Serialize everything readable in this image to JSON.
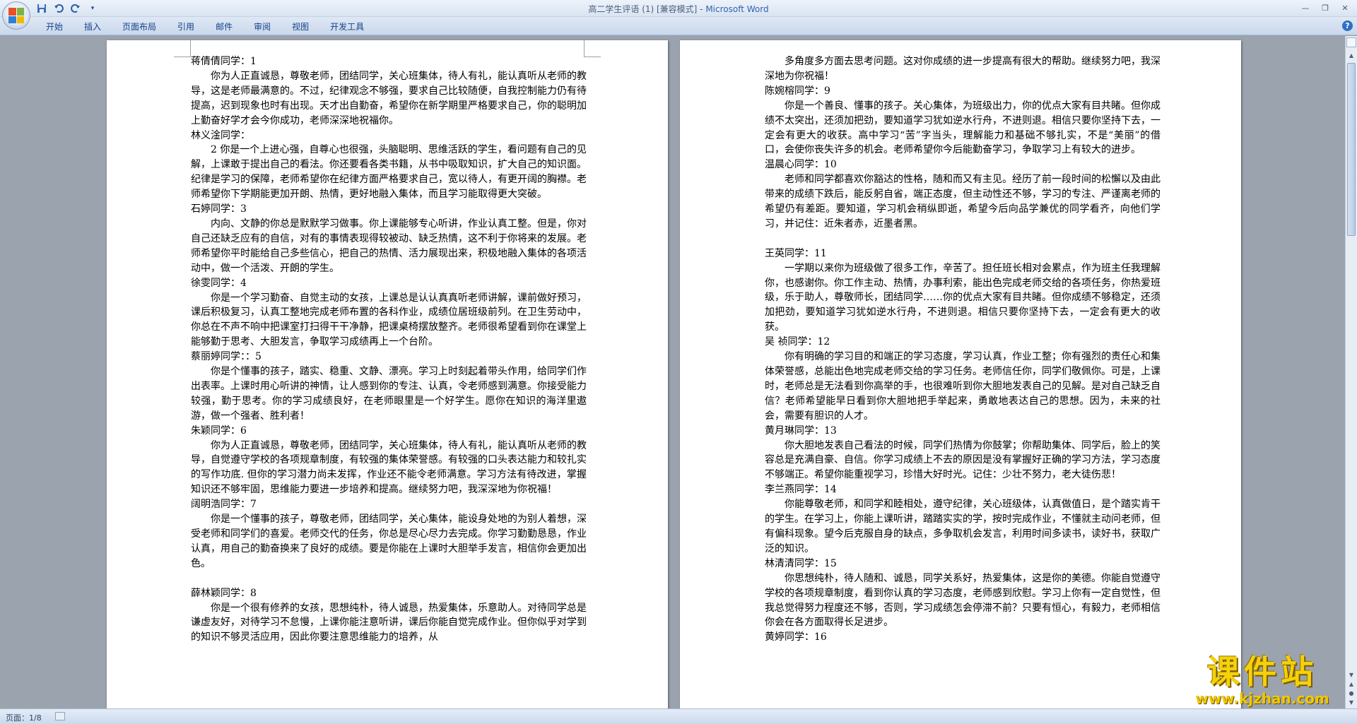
{
  "window": {
    "title": "高二学生评语 (1) [兼容模式] - ",
    "app_name": "Microsoft Word"
  },
  "quick_access": {
    "save_icon": "save-icon",
    "undo_icon": "undo-icon",
    "redo_icon": "redo-icon",
    "customize_icon": "customize-icon"
  },
  "ribbon": {
    "tabs": [
      "开始",
      "插入",
      "页面布局",
      "引用",
      "邮件",
      "审阅",
      "视图",
      "开发工具"
    ]
  },
  "document": {
    "left_page": [
      {
        "name": "蒋倩倩同学：1",
        "body": "你为人正直诚恳，尊敬老师，团结同学，关心班集体，待人有礼，能认真听从老师的教导，这是老师最满意的。不过，纪律观念不够强，要求自己比较随便，自我控制能力仍有待提高，迟到现象也时有出现。天才出自勤奋，希望你在新学期里严格要求自己，你的聪明加上勤奋好学才会今你成功，老师深深地祝福你。"
      },
      {
        "name": "林义淦同学：",
        "body": "2 你是一个上进心强，自尊心也很强，头脑聪明、思维活跃的学生，看问题有自己的见解，上课敢于提出自己的看法。你还要看各类书籍，从书中吸取知识，扩大自己的知识面。纪律是学习的保障，老师希望你在纪律方面严格要求自己，宽以待人，有更开阔的胸襟。老师希望你下学期能更加开朗、热情，更好地融入集体，而且学习能取得更大突破。"
      },
      {
        "name": "石婷同学：3",
        "body": " 内向、文静的你总是默默学习做事。你上课能够专心听讲，作业认真工整。但是，你对自己还缺乏应有的自信，对有的事情表现得较被动、缺乏热情，这不利于你将来的发展。老师希望你平时能给自己多些信心，把自己的热情、活力展现出来，积极地融入集体的各项活动中，做一个活泼、开朗的学生。"
      },
      {
        "name": "徐雯同学：4",
        "body": "你是一个学习勤奋、自觉主动的女孩，上课总是认认真真听老师讲解，课前做好预习，课后积极复习，认真工整地完成老师布置的各科作业，成绩位居班级前列。在卫生劳动中，你总在不声不响中把课室打扫得干干净静，把课桌椅摆放整齐。老师很希望看到你在课堂上能够勤于思考、大胆发言，争取学习成绩再上一个台阶。"
      },
      {
        "name": "蔡丽婷同学：：5",
        "body": "你是个懂事的孩子，踏实、稳重、文静、漂亮。学习上时刻起着带头作用，给同学们作出表率。上课时用心听讲的神情，让人感到你的专注、认真，令老师感到满意。你接受能力较强，勤于思考。你的学习成绩良好，在老师眼里是一个好学生。愿你在知识的海洋里遨游，做一个强者、胜利者！"
      },
      {
        "name": "朱颖同学：6",
        "body": "你为人正直诚恳，尊敬老师，团结同学，关心班集体，待人有礼，能认真听从老师的教导，自觉遵守学校的各项规章制度，有较强的集体荣誉感。有较强的口头表达能力和较扎实的写作功底. 但你的学习潜力尚未发挥，作业还不能令老师满意。学习方法有待改进，掌握知识还不够牢固，思维能力要进一步培养和提高。继续努力吧，我深深地为你祝福！"
      },
      {
        "name": "阔明浩同学：7",
        "body": "你是一个懂事的孩子，尊敬老师，团结同学，关心集体，能设身处地的为别人着想，深受老师和同学们的喜爱。老师交代的任务，你总是尽心尽力去完成。你学习勤勤恳恳，作业认真，用自己的勤奋换来了良好的成绩。要是你能在上课时大胆举手发言，相信你会更加出色。"
      },
      {
        "name": "",
        "body": ""
      },
      {
        "name": "薛林颖同学：8",
        "body": "你是一个很有修养的女孩，思想纯朴，待人诚恳，热爱集体，乐意助人。对待同学总是谦虚友好，对待学习不怠慢，上课你能注意听讲，课后你能自觉完成作业。但你似乎对学到的知识不够灵活应用，因此你要注意思维能力的培养，从"
      }
    ],
    "right_page": [
      {
        "name": "",
        "body": "多角度多方面去思考问题。这对你成绩的进一步提高有很大的帮助。继续努力吧，我深深地为你祝福！"
      },
      {
        "name": "陈婉榕同学：9",
        "body": " 你是一个善良、懂事的孩子。关心集体，为班级出力，你的优点大家有目共睹。但你成绩不太突出，还须加把劲，要知道学习犹如逆水行舟，不进则退。相信只要你坚持下去，一定会有更大的收获。高中学习“苦”字当头，理解能力和基础不够扎实，不是“美丽”的借口，会使你丧失许多的机会。老师希望你今后能勤奋学习，争取学习上有较大的进步。"
      },
      {
        "name": "温晨心同学：10",
        "body": ""
      },
      {
        "name": "",
        "body": "老师和同学都喜欢你豁达的性格，随和而又有主见。经历了前一段时间的松懈以及由此带来的成绩下跌后，能反躬自省，端正态度，但主动性还不够，学习的专注、严谨离老师的希望仍有差距。要知道，学习机会稍纵即逝，希望今后向品学兼优的同学看齐，向他们学习，并记住：近朱者赤，近墨者黑。"
      },
      {
        "name": "",
        "body": ""
      },
      {
        "name": "王英同学：11",
        "body": "一学期以来你为班级做了很多工作，辛苦了。担任班长相对会累点，作为班主任我理解你，也感谢你。你工作主动、热情，办事利索，能出色完成老师交给的各项任务，你热爱班级，乐于助人，尊敬师长，团结同学……你的优点大家有目共睹。但你成绩不够稳定，还须加把劲，要知道学习犹如逆水行舟，不进则退。相信只要你坚持下去，一定会有更大的收获。"
      },
      {
        "name": "吴 祯同学：12",
        "body": " 你有明确的学习目的和端正的学习态度，学习认真，作业工整；你有强烈的责任心和集体荣誉感，总能出色地完成老师交给的学习任务。老师信任你，同学们敬佩你。可是，上课时，老师总是无法看到你高举的手，也很难听到你大胆地发表自己的见解。是对自己缺乏自信？老师希望能早日看到你大胆地把手举起来，勇敢地表达自己的思想。因为，未来的社会，需要有胆识的人才。"
      },
      {
        "name": "黄月琳同学：13",
        "body": "你大胆地发表自己看法的时候，同学们热情为你鼓掌；你帮助集体、同学后，脸上的笑容总是充满自豪、自信。你学习成绩上不去的原因是没有掌握好正确的学习方法，学习态度不够端正。希望你能重视学习，珍惜大好时光。记住：少壮不努力，老大徒伤悲！"
      },
      {
        "name": "李兰燕同学：14",
        "body": " 你能尊敬老师，和同学和睦相处，遵守纪律，关心班级体，认真做值日，是个踏实肯干的学生。在学习上，你能上课听讲，踏踏实实的学，按时完成作业，不懂就主动问老师，但有偏科现象。望今后克服自身的缺点，多争取机会发言，利用时间多读书，读好书，获取广泛的知识。"
      },
      {
        "name": "林清清同学：15",
        "body": "你思想纯朴，待人随和、诚恳，同学关系好，热爱集体，这是你的美德。你能自觉遵守学校的各项规章制度，看到你认真的学习态度，老师感到欣慰。学习上你有一定自觉性，但我总觉得努力程度还不够，否则，学习成绩怎会停滞不前？只要有恒心，有毅力，老师相信你会在各方面取得长足进步。"
      },
      {
        "name": "黄婷同学：16",
        "body": ""
      }
    ]
  },
  "status_bar": {
    "page_info": "页面：1/8"
  },
  "watermark": {
    "text": "课件站",
    "url": "www.kjzhan.com"
  }
}
